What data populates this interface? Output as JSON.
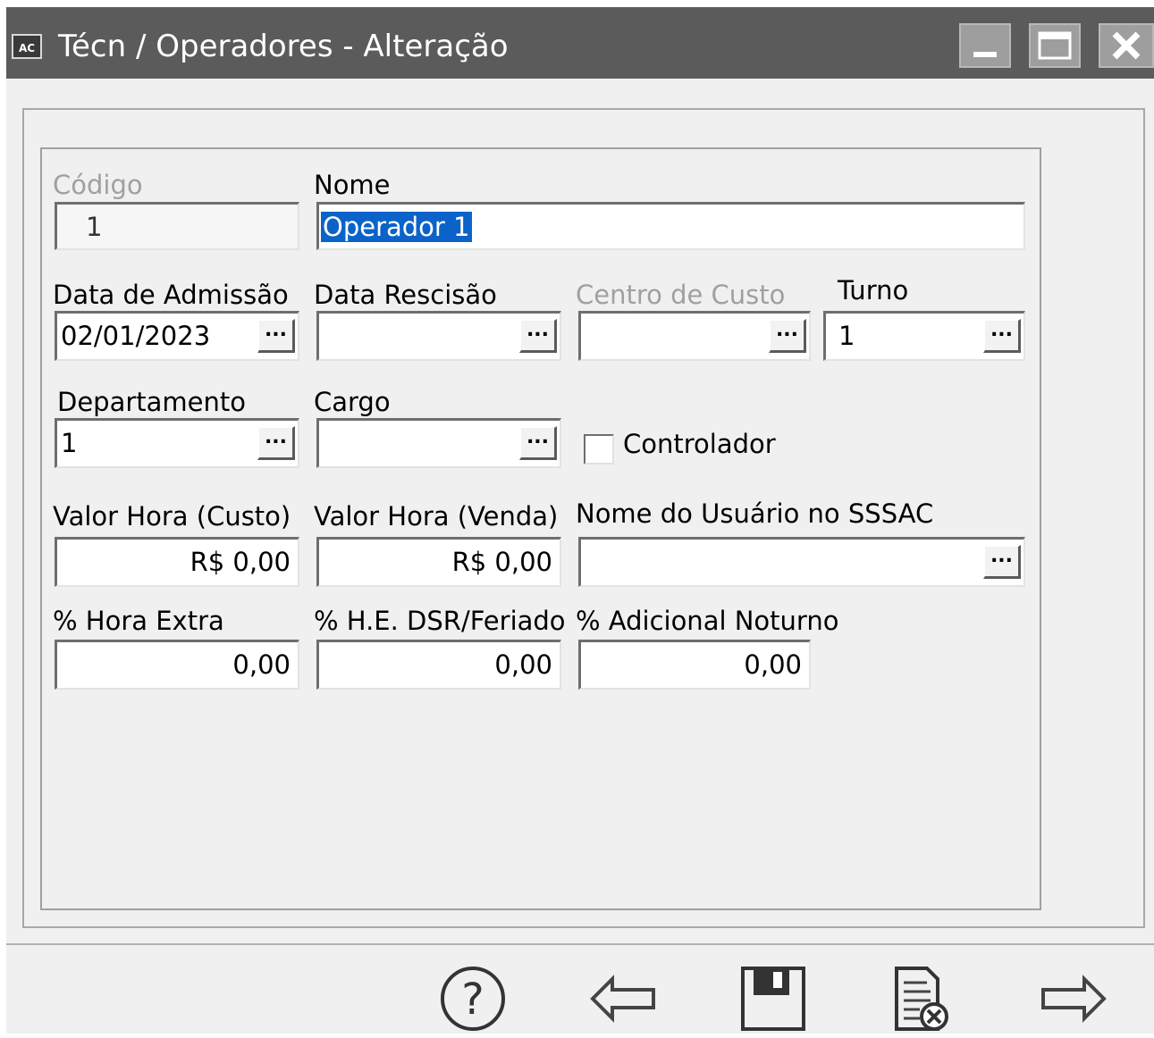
{
  "window": {
    "title": "Técn / Operadores - Alteração",
    "app_icon_text": "AC"
  },
  "form": {
    "codigo": {
      "label": "Código",
      "value": "1"
    },
    "nome": {
      "label": "Nome",
      "value": "Operador 1"
    },
    "data_admissao": {
      "label": "Data de Admissão",
      "value": "02/01/2023"
    },
    "data_rescisao": {
      "label": "Data Rescisão",
      "value": ""
    },
    "centro_custo": {
      "label": "Centro de Custo",
      "value": ""
    },
    "turno": {
      "label": "Turno",
      "value": "1"
    },
    "departamento": {
      "label": "Departamento",
      "value": "1"
    },
    "cargo": {
      "label": "Cargo",
      "value": ""
    },
    "controlador": {
      "label": "Controlador",
      "checked": false
    },
    "valor_hora_custo": {
      "label": "Valor Hora (Custo)",
      "value": "R$ 0,00"
    },
    "valor_hora_venda": {
      "label": "Valor Hora (Venda)",
      "value": "R$ 0,00"
    },
    "usuario_sssac": {
      "label": "Nome do Usuário no SSSAC",
      "value": ""
    },
    "hora_extra": {
      "label": "% Hora Extra",
      "value": "0,00"
    },
    "he_dsr_feriado": {
      "label": "% H.E. DSR/Feriado",
      "value": "0,00"
    },
    "adicional_noturno": {
      "label": "% Adicional Noturno",
      "value": "0,00"
    },
    "ellipsis": "..."
  },
  "toolbar": {
    "icons": [
      "help-icon",
      "back-arrow-icon",
      "save-icon",
      "cancel-document-icon",
      "forward-arrow-icon"
    ]
  },
  "colors": {
    "titlebar": "#5b5b5b",
    "background": "#f0f0f0",
    "selection": "#0b63c9"
  }
}
